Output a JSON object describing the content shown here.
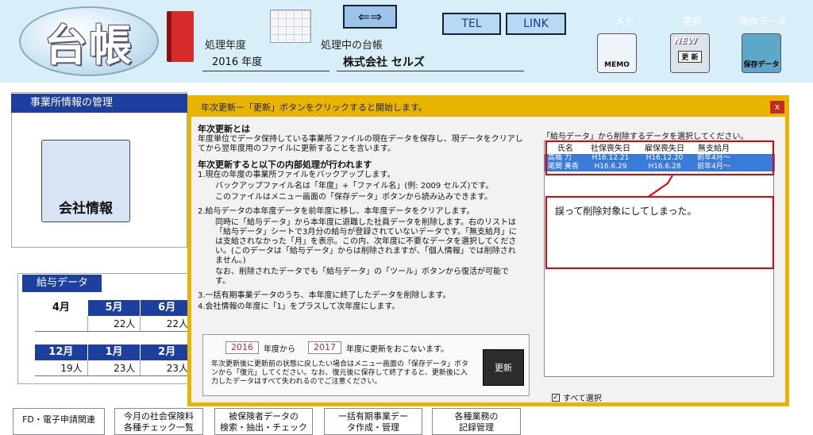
{
  "header": {
    "logo_text": "台帳",
    "year_label": "処理年度",
    "book_label": "処理中の台帳",
    "year_value": "2016 年度",
    "company_value": "株式会社 セルズ",
    "tel_label": "TEL",
    "link_label": "LINK",
    "memo_top": "メモ",
    "memo_icon_text": "MEMO",
    "update_top": "更新",
    "update_icon_text": "更 新",
    "update_new": "NEW",
    "save_top": "保存データ",
    "save_icon_text": "保存データ",
    "arrow_icon": "⇐⇒"
  },
  "office": {
    "title": "事業所情報の管理",
    "company_button": "会社情報"
  },
  "salary": {
    "title": "給与データ",
    "row1_months": [
      "4月",
      "5月",
      "6月"
    ],
    "row1_values": [
      "",
      "22人",
      "22人"
    ],
    "row2_months": [
      "12月",
      "1月",
      "2月"
    ],
    "row2_values": [
      "19人",
      "23人",
      "23人"
    ]
  },
  "bottom_tabs": [
    "FD・電子申請関連",
    "今月の社会保険料\n各種チェック一覧",
    "被保険者データの\n検索・抽出・チェック",
    "一括有期事業デー\nタ作成・管理",
    "各種業務の\n記録管理"
  ],
  "dialog": {
    "title": "年次更新－「更新」ボタンをクリックすると開始します。",
    "close": "x",
    "h1": "年次更新とは",
    "p1": "年度単位でデータ保持している事業所ファイルの現在データを保存し、現データをクリアしてから翌年度用のファイルに更新することを言います。",
    "h2": "年次更新すると以下の内部処理が行われます",
    "s1": "1.現在の年度の事業所ファイルをバックアップします。",
    "s1a": "バックアップファイル名は「年度」+「ファイル名」(例: 2009 セルズ)です。",
    "s1b": "このファイルはメニュー画面の「保存データ」ボタンから読み込みできます。",
    "s2": "2.給与データの本年度データを前年度に移し、本年度データをクリアします。",
    "s2a": "同時に「給与データ」から本年度に退職した社員データを削除します。右のリストは「給与データ」シートで3月分の給与が登録されていないデータです。「無支給月」には支給されなかった「月」を表示。この内、次年度に不要なデータを選択してください。(このデータは「給与データ」からは削除されますが、「個人情報」では削除されません。)",
    "s2b": "なお、削除されたデータでも「給与データ」の「ツール」ボタンから復活が可能です。",
    "s3": "3.一括有期事業データのうち、本年度に終了したデータを削除します。",
    "s4": "4.会社情報の年度に「1」をプラスして次年度にします。",
    "from_year": "2016",
    "from_text": "年度から",
    "to_year": "2017",
    "to_text": "年度に更新をおこないます。",
    "note": "年次更新後に更新前の状態に戻したい場合はメニュー画面の「保存データ」ボタンから「復元」してください。なお、復元後に保存して終了すると、更新後に入力したデータはすべて失われるのでご注意ください。",
    "update_button": "更新",
    "right_intro": "「給与データ」から削除するデータを選択してください。",
    "columns": [
      "氏名",
      "社保喪失日",
      "雇保喪失日",
      "無支給月"
    ],
    "rows": [
      [
        "高橋 力",
        "H16.12.21",
        "H16.12.20",
        "前年4月～"
      ],
      [
        "尾関 美香",
        "H16.6.29",
        "H16.6.28",
        "前年4月～"
      ]
    ],
    "callout": "誤って削除対象にしてしまった。",
    "select_all": "すべて選択",
    "select_all_mark": "✓"
  }
}
